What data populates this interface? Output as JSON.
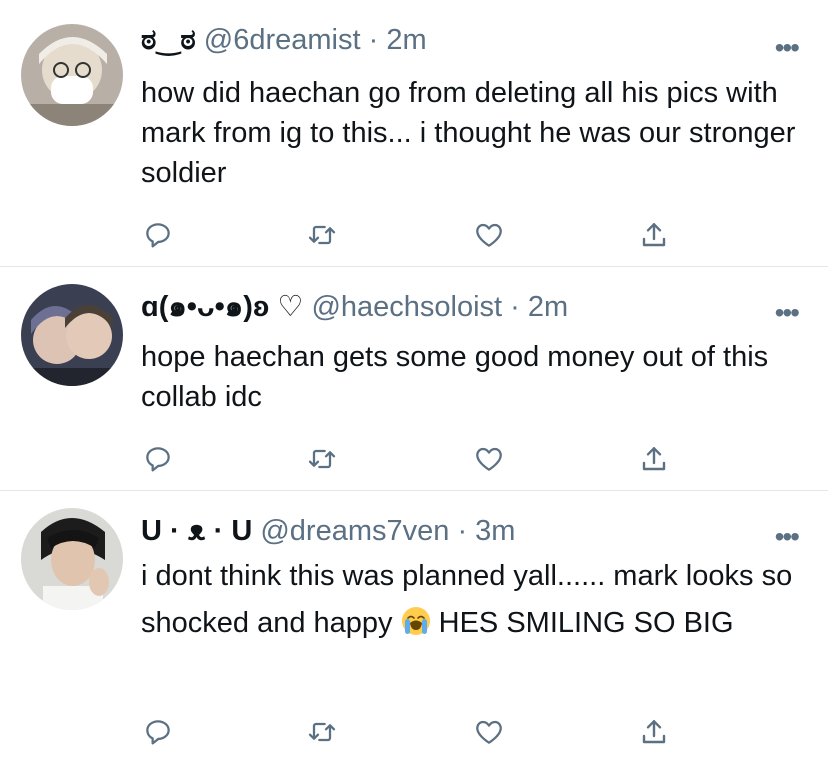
{
  "tweets": [
    {
      "name": "ಠ‿ಠ",
      "handle": "@6dreamist",
      "time": "2m",
      "text": "how did haechan go from deleting all his pics with mark from ig to this... i thought he was our stronger soldier"
    },
    {
      "name": "ɑ(๑•ᴗ•๑)ʚ ♡",
      "handle": "@haechsoloist",
      "time": "2m",
      "text": "hope haechan gets some good money out of this collab idc"
    },
    {
      "name": "U · ᴥ · U",
      "handle": "@dreams7ven",
      "time": "3m",
      "text_before_emoji": "i dont think this was planned yall...... mark looks so shocked and happy ",
      "emoji": "loudly-crying-face",
      "text_after_emoji": " HES SMILING SO BIG"
    }
  ],
  "separator": "·",
  "more_label": "•••",
  "colors": {
    "text": "#0f1419",
    "muted": "#5b7083",
    "divider": "#e1e8ed"
  },
  "icons": [
    "reply-icon",
    "retweet-icon",
    "like-icon",
    "share-icon",
    "more-icon"
  ]
}
